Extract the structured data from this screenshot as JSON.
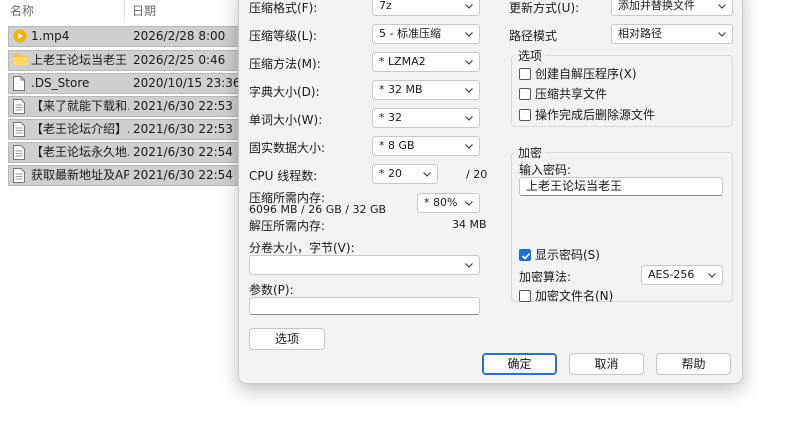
{
  "explorer": {
    "col_name": "名称",
    "col_date": "日期",
    "files": [
      {
        "name": "1.mp4",
        "date": "2026/2/28 8:00",
        "icon": "media-icon"
      },
      {
        "name": "上老王论坛当老王",
        "date": "2026/2/25 0:46",
        "icon": "folder-icon"
      },
      {
        "name": ".DS_Store",
        "date": "2020/10/15 23:36",
        "icon": "file-icon"
      },
      {
        "name": "【来了就能下载和...",
        "date": "2021/6/30 22:53",
        "icon": "document-icon"
      },
      {
        "name": "【老王论坛介绍】.txt",
        "date": "2021/6/30 22:53",
        "icon": "document-icon"
      },
      {
        "name": "【老王论坛永久地...",
        "date": "2021/6/30 22:54",
        "icon": "document-icon"
      },
      {
        "name": "获取最新地址及AP...",
        "date": "2021/6/30 22:54",
        "icon": "document-icon"
      }
    ]
  },
  "dialog": {
    "left": {
      "format_label": "压缩格式(F):",
      "format_value": "7z",
      "level_label": "压缩等级(L):",
      "level_value": "5 - 标准压缩",
      "method_label": "压缩方法(M):",
      "method_value": "* LZMA2",
      "dict_label": "字典大小(D):",
      "dict_value": "* 32 MB",
      "word_label": "单词大小(W):",
      "word_value": "* 32",
      "solid_label": "固实数据大小:",
      "solid_value": "* 8 GB",
      "cpu_label": "CPU 线程数:",
      "cpu_value": "* 20",
      "cpu_total": "/ 20",
      "mem_label": "压缩所需内存:",
      "mem_detail": "6096 MB / 26 GB / 32 GB",
      "mem_percent": "* 80%",
      "decomp_label": "解压所需内存:",
      "decomp_value": "34 MB",
      "volume_label": "分卷大小，字节(V):",
      "volume_value": "",
      "params_label": "参数(P):",
      "params_value": "",
      "options_button": "选项"
    },
    "right": {
      "update_label": "更新方式(U):",
      "update_value": "添加并替换文件",
      "path_label": "路径模式",
      "path_value": "相对路径",
      "options_group": "选项",
      "opt_sfx": "创建自解压程序(X)",
      "opt_shared": "压缩共享文件",
      "opt_delete": "操作完成后删除源文件",
      "encrypt_group": "加密",
      "password_label": "输入密码:",
      "password_value": "上老王论坛当老王",
      "show_password": "显示密码(S)",
      "show_password_checked": true,
      "algo_label": "加密算法:",
      "algo_value": "AES-256",
      "encrypt_names": "加密文件名(N)"
    },
    "buttons": {
      "ok": "确定",
      "cancel": "取消",
      "help": "帮助"
    }
  }
}
